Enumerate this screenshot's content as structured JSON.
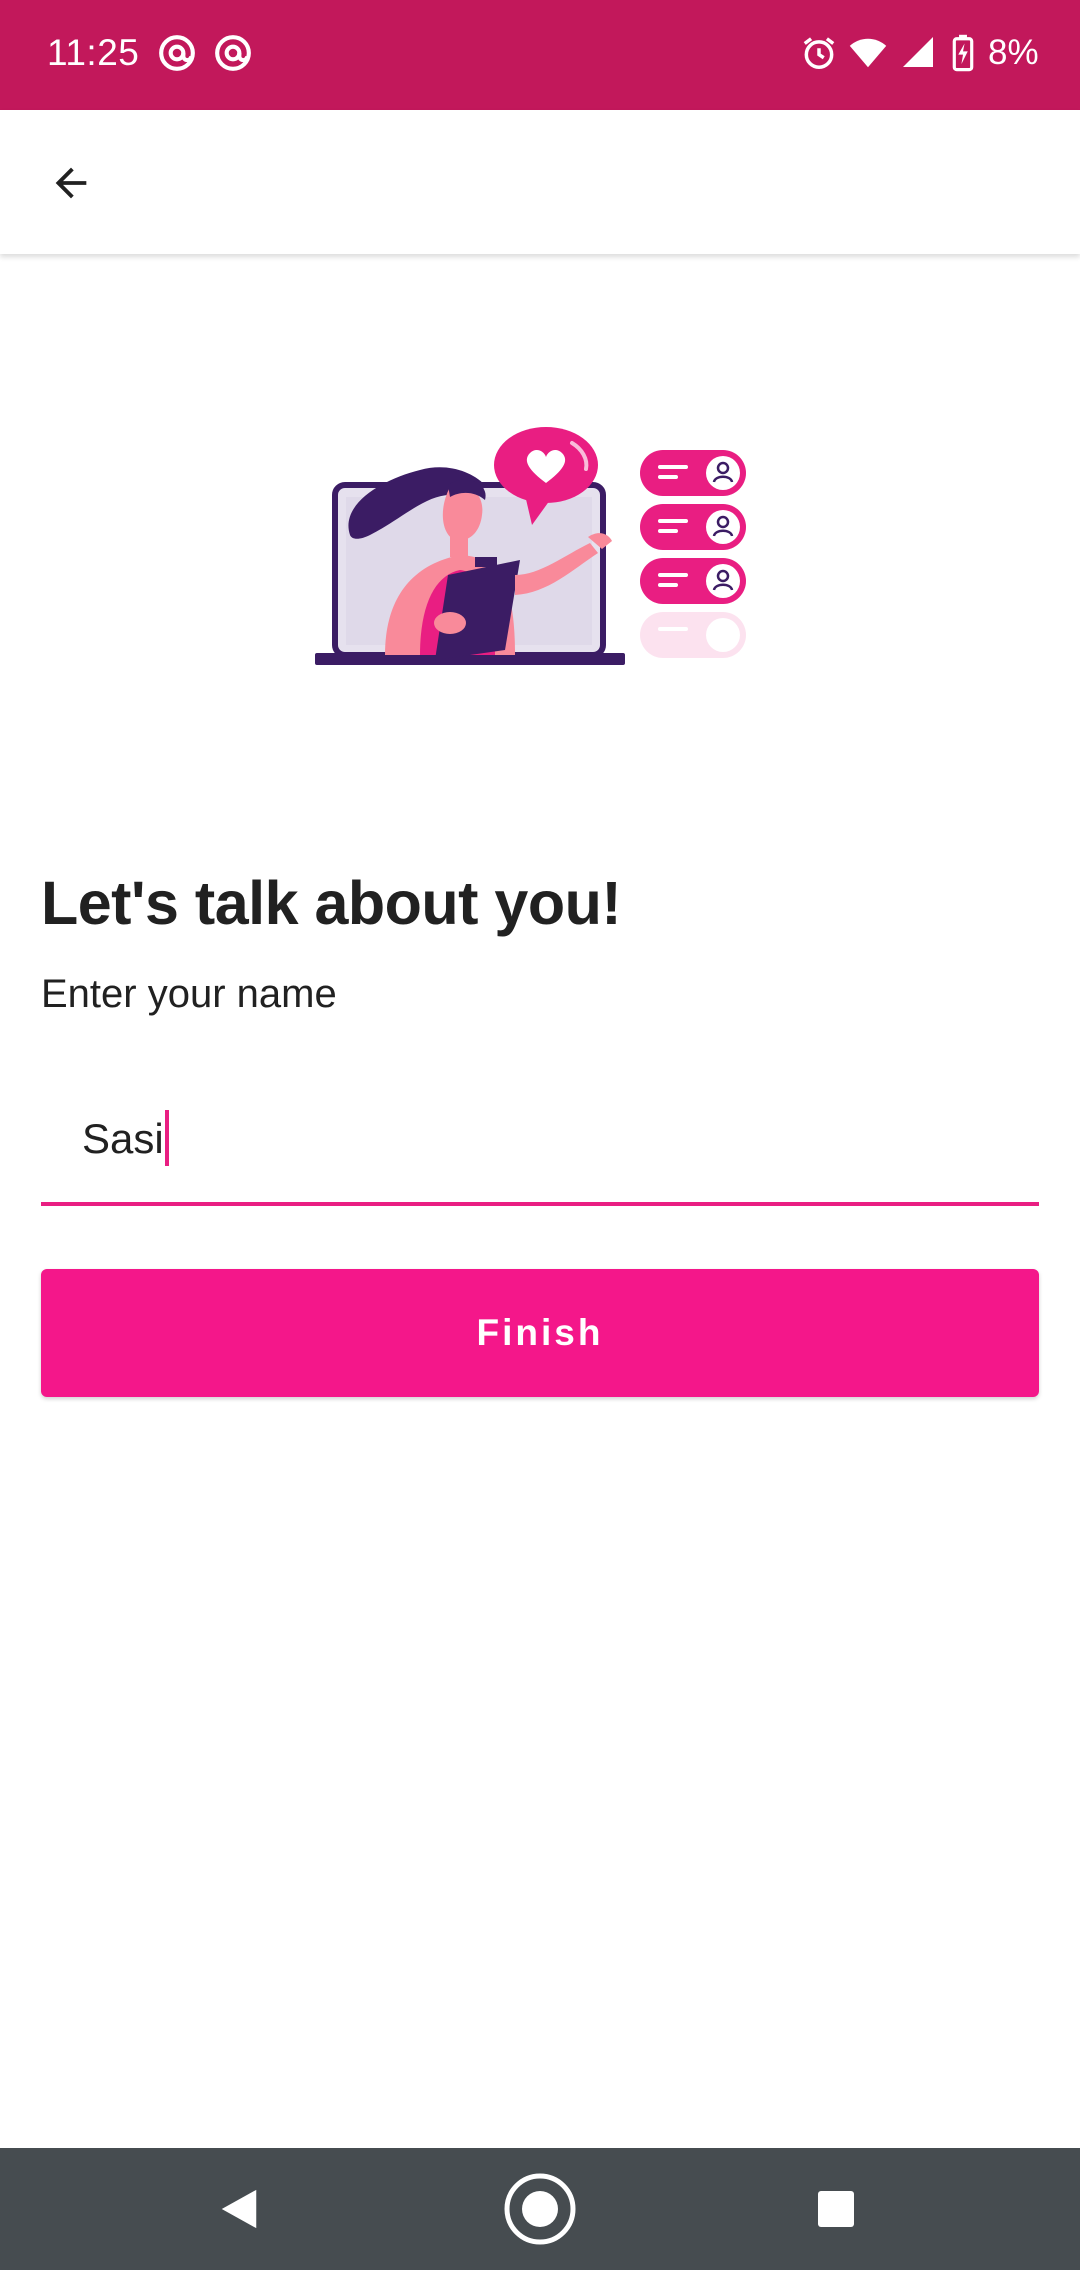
{
  "status_bar": {
    "time": "11:25",
    "battery": "8%",
    "notification_icons": [
      "at-sign-icon",
      "at-sign-icon"
    ],
    "system_icons": [
      "alarm-icon",
      "wifi-icon",
      "cell-signal-icon",
      "battery-charging-icon"
    ]
  },
  "app_bar": {
    "back_icon": "arrow-back-icon"
  },
  "main": {
    "title": "Let's talk about you!",
    "subtitle": "Enter your name",
    "name_input": {
      "value": "Sasi"
    },
    "finish_button": "Finish"
  },
  "nav_bar": {
    "items": [
      "back-triangle-icon",
      "home-circle-icon",
      "recents-square-icon"
    ]
  },
  "colors": {
    "status_bar": "#C2185B",
    "accent": "#F4178A",
    "illustration_purple": "#3B1C64",
    "nav_bar": "#464C50"
  }
}
